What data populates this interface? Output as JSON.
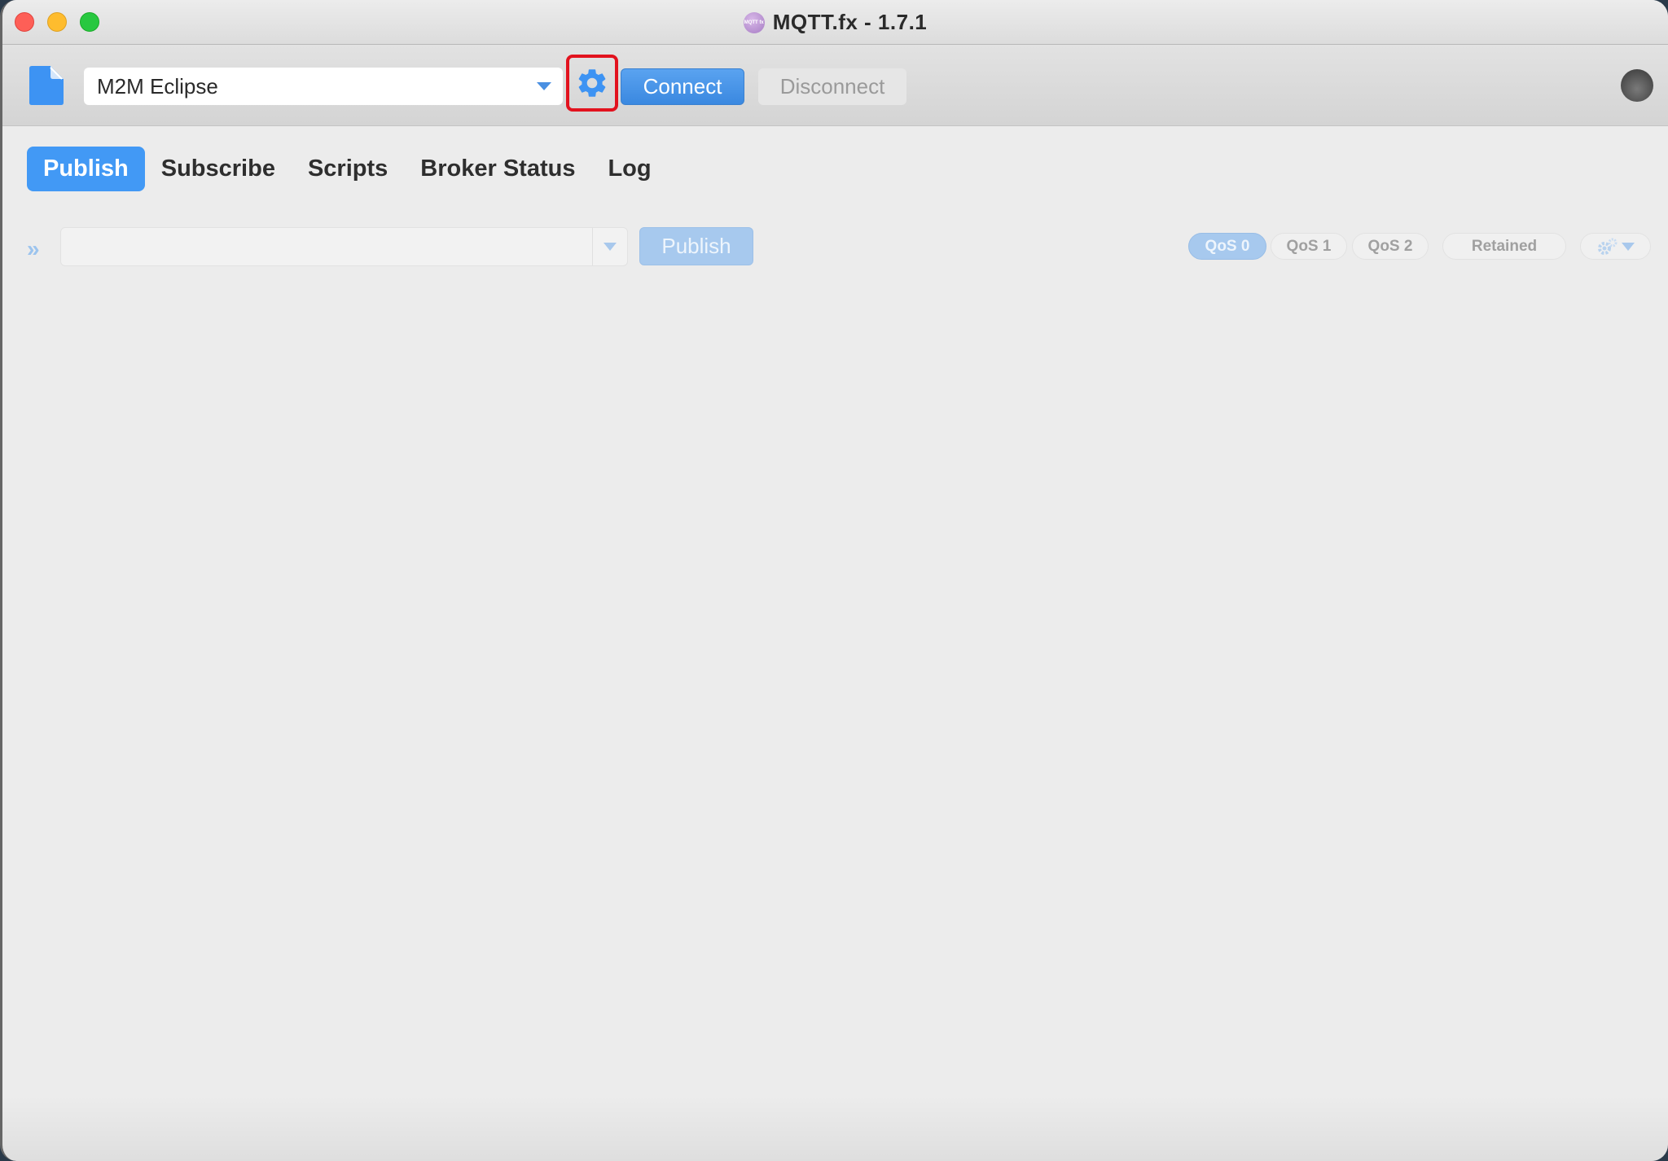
{
  "window": {
    "title": "MQTT.fx - 1.7.1",
    "app_icon_text": "MQTT fx"
  },
  "toolbar": {
    "profile_selected": "M2M Eclipse",
    "connect_label": "Connect",
    "disconnect_label": "Disconnect",
    "settings_highlighted": true,
    "connection_status": "disconnected"
  },
  "tabs": [
    {
      "label": "Publish",
      "active": true
    },
    {
      "label": "Subscribe",
      "active": false
    },
    {
      "label": "Scripts",
      "active": false
    },
    {
      "label": "Broker Status",
      "active": false
    },
    {
      "label": "Log",
      "active": false
    }
  ],
  "publish": {
    "expand_icon": "»",
    "topic_value": "",
    "publish_label": "Publish",
    "qos": [
      {
        "label": "QoS 0",
        "active": true
      },
      {
        "label": "QoS 1",
        "active": false
      },
      {
        "label": "QoS 2",
        "active": false
      }
    ],
    "retained_label": "Retained"
  },
  "colors": {
    "accent": "#4299f5",
    "highlight_box": "#e2121e",
    "disabled_blue": "#a7c9ee"
  }
}
